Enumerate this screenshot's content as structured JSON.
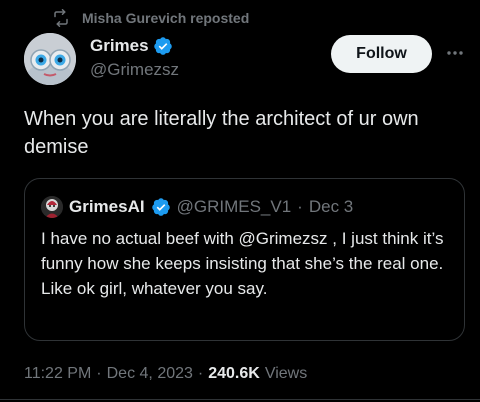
{
  "repost": {
    "text": "Misha Gurevich reposted"
  },
  "author": {
    "name": "Grimes",
    "handle": "@Grimezsz"
  },
  "follow_label": "Follow",
  "tweet": {
    "text": "When you are literally the architect of ur own demise"
  },
  "quote": {
    "name": "GrimesAI",
    "handle": "@GRIMES_V1",
    "separator": "·",
    "date": "Dec 3",
    "text": "I have no actual beef with @Grimezsz , I just think it’s funny how she keeps insisting that she’s the real one.  Like ok girl, whatever you say."
  },
  "meta": {
    "time": "11:22 PM",
    "sep1": "·",
    "date": "Dec 4, 2023",
    "sep2": "·",
    "views_count": "240.6K",
    "views_label": "Views"
  },
  "colors": {
    "background": "#000000",
    "text": "#e7e9ea",
    "muted": "#71767b",
    "verified": "#1d9bf0",
    "border": "#2f3336"
  }
}
